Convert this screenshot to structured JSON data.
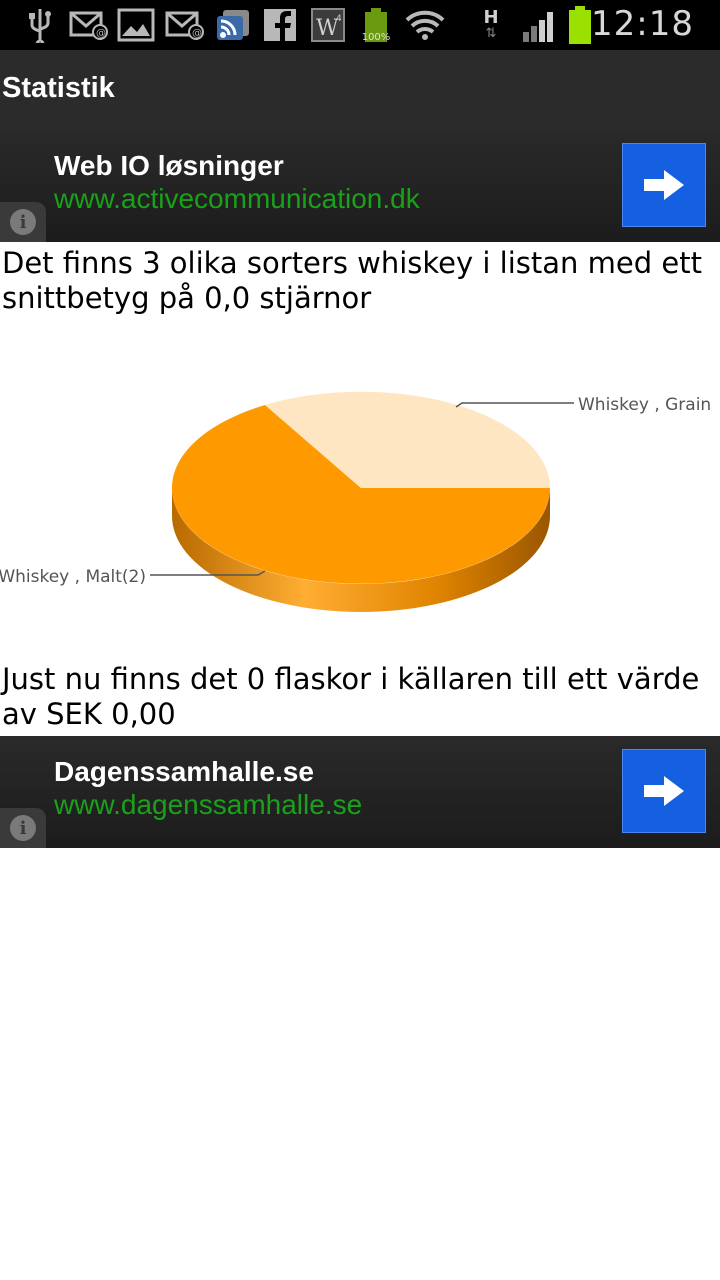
{
  "status_bar": {
    "icons": [
      "usb-icon",
      "email-icon",
      "gallery-icon",
      "email-icon",
      "rss-icon",
      "facebook-icon",
      "w4-icon",
      "battery-icon",
      "wifi-icon",
      "network-h-icon",
      "signal-icon",
      "battery-icon"
    ],
    "battery_label": "100%",
    "network_label": "H",
    "time": "12:18"
  },
  "app": {
    "title": "Statistik"
  },
  "ad_top": {
    "title": "Web IO løsninger",
    "url": "www.activecommunication.dk"
  },
  "summary_text": "Det finns 3 olika sorters whiskey i listan med ett snittbetyg på 0,0 stjärnor",
  "chart_data": {
    "type": "pie",
    "slices": [
      {
        "label": "Whiskey , Grain",
        "value": 1,
        "color": "#ffe6c2"
      },
      {
        "label": "Whiskey , Malt(2)",
        "value": 2,
        "color": "#ff9900"
      }
    ],
    "labels": {
      "grain": "Whiskey , Grain",
      "malt": "Whiskey , Malt(2)"
    }
  },
  "cellar_text": "Just nu finns det 0 flaskor i källaren till ett värde av SEK 0,00",
  "ad_bottom": {
    "title": "Dagenssamhalle.se",
    "url": "www.dagenssamhalle.se"
  },
  "colors": {
    "ad_url_green": "#1aa11a",
    "ad_button_blue": "#1560e0",
    "pie_orange": "#ff9900",
    "pie_light": "#ffe6c2"
  }
}
